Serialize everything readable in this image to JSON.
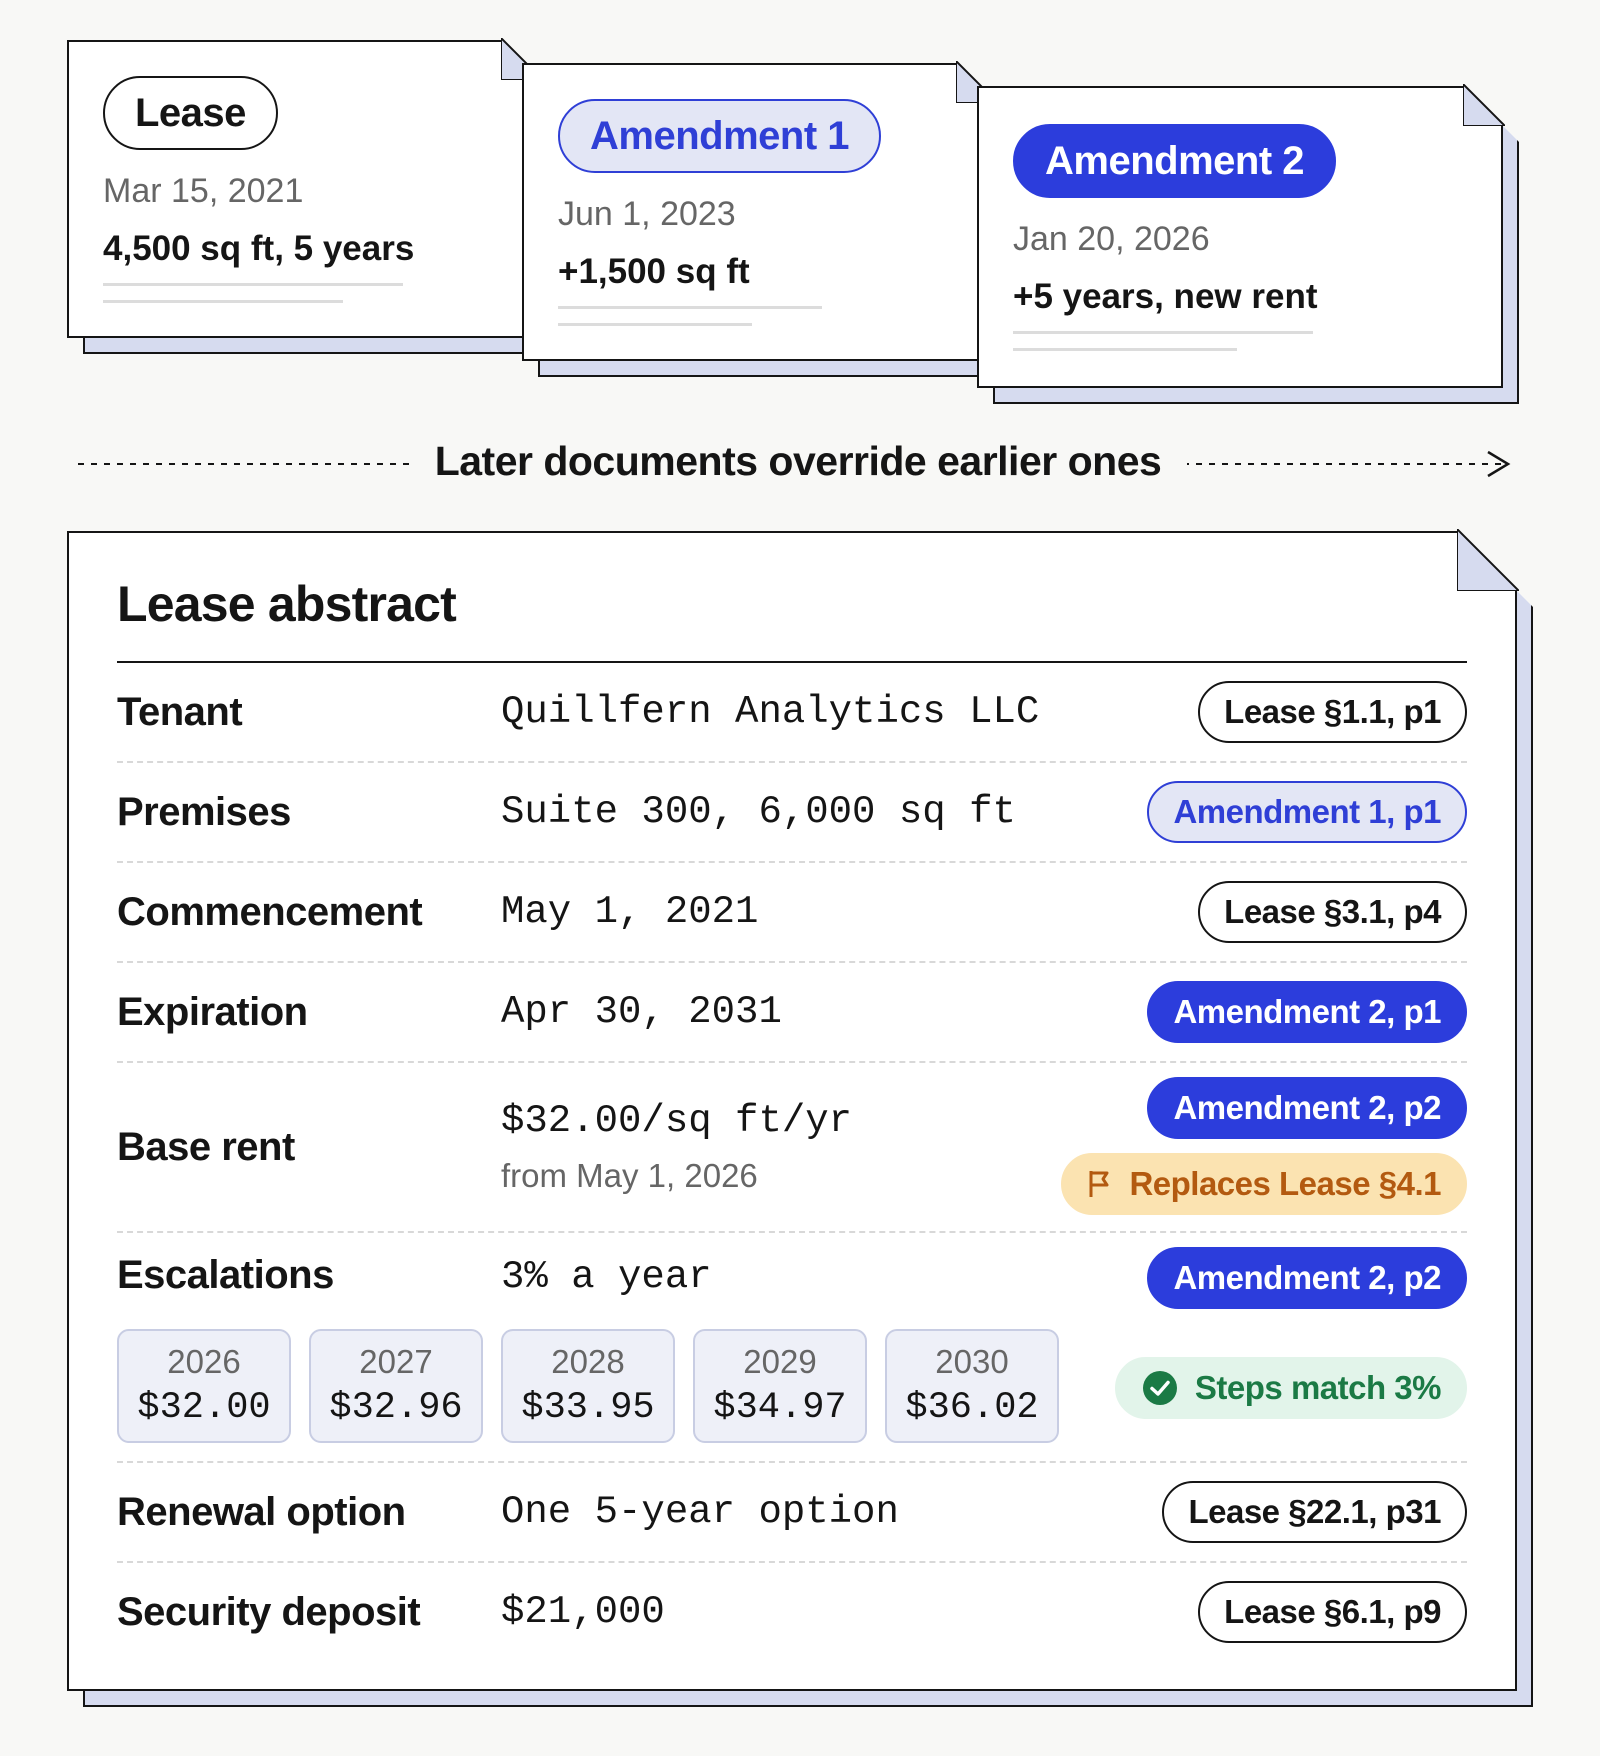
{
  "documents": [
    {
      "tag": "Lease",
      "date": "Mar 15, 2021",
      "summary": "4,500 sq ft, 5 years"
    },
    {
      "tag": "Amendment 1",
      "date": "Jun 1, 2023",
      "summary": "+1,500 sq ft"
    },
    {
      "tag": "Amendment 2",
      "date": "Jan 20, 2026",
      "summary": "+5 years, new rent"
    }
  ],
  "banner": {
    "text": "Later documents override earlier ones"
  },
  "abstract": {
    "title": "Lease abstract",
    "rows": {
      "tenant": {
        "label": "Tenant",
        "value": "Quillfern Analytics LLC",
        "source": "Lease §1.1, p1"
      },
      "premises": {
        "label": "Premises",
        "value": "Suite 300, 6,000 sq ft",
        "source": "Amendment 1, p1"
      },
      "commencement": {
        "label": "Commencement",
        "value": "May 1, 2021",
        "source": "Lease §3.1, p4"
      },
      "expiration": {
        "label": "Expiration",
        "value": "Apr 30, 2031",
        "source": "Amendment 2, p1"
      },
      "base_rent": {
        "label": "Base rent",
        "value": "$32.00/sq ft/yr",
        "sub": "from May 1, 2026",
        "source": "Amendment 2, p2",
        "note": "Replaces Lease §4.1"
      },
      "escalations": {
        "label": "Escalations",
        "value": "3% a year",
        "source": "Amendment 2, p2",
        "check": "Steps match 3%",
        "steps": [
          {
            "year": "2026",
            "rent": "$32.00"
          },
          {
            "year": "2027",
            "rent": "$32.96"
          },
          {
            "year": "2028",
            "rent": "$33.95"
          },
          {
            "year": "2029",
            "rent": "$34.97"
          },
          {
            "year": "2030",
            "rent": "$36.02"
          }
        ]
      },
      "renewal": {
        "label": "Renewal option",
        "value": "One 5-year option",
        "source": "Lease §22.1, p31"
      },
      "deposit": {
        "label": "Security deposit",
        "value": "$21,000",
        "source": "Lease §6.1, p9"
      }
    }
  },
  "colors": {
    "accent": "#2c3ddc",
    "accent_soft": "#e3e6f5",
    "shadow": "#d6dbef",
    "warning_bg": "#fbe3b1",
    "warning_text": "#b35a10",
    "success_bg": "#e2f4ea",
    "success_text": "#1b7a45"
  },
  "icons": {
    "note": "flag-icon",
    "check": "check-circle-icon",
    "banner_arrow": "arrow-right-icon"
  }
}
